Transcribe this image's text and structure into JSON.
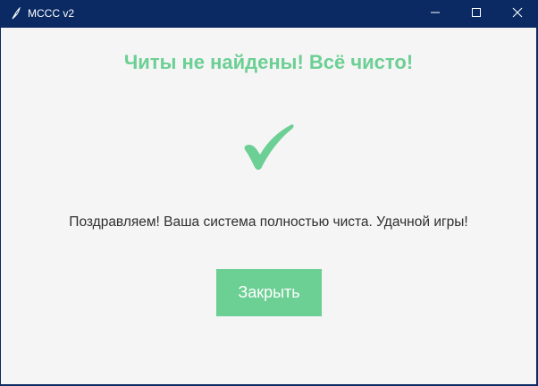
{
  "window": {
    "title": "MCCC v2",
    "app_icon": "feather-icon",
    "controls": {
      "minimize_icon": "minimize-icon",
      "maximize_icon": "maximize-icon",
      "close_icon": "close-icon"
    }
  },
  "dialog": {
    "heading": "Читы не найдены! Всё чисто!",
    "status_icon": "checkmark-icon",
    "message": "Поздравляем! Ваша система полностью чиста. Удачной игры!",
    "close_button_label": "Закрыть"
  },
  "colors": {
    "titlebar": "#0b2a63",
    "accent_green": "#6ccf94",
    "background": "#f5f5f5",
    "text": "#2f2f2f"
  }
}
